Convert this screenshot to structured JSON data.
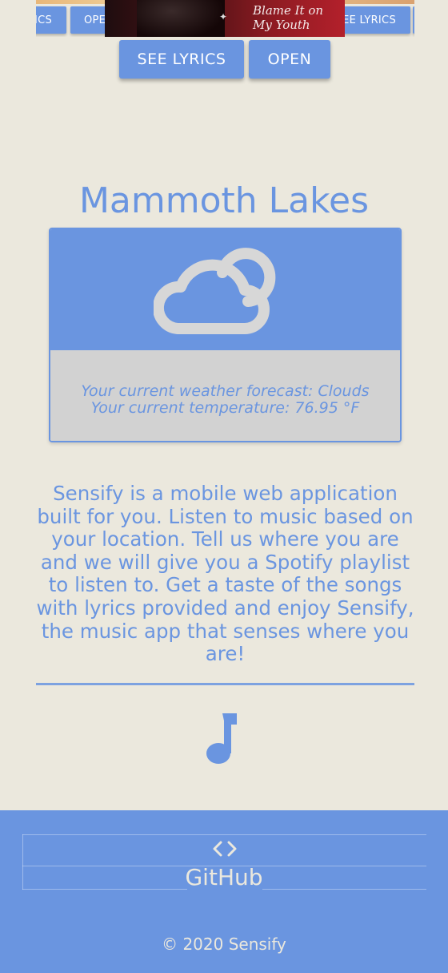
{
  "carousel": {
    "left_button_partial": "ICS",
    "open_button_partial": "OPE",
    "right_button_partial": "EE LYRICS",
    "album_title": "Blame It on My Youth"
  },
  "actions": {
    "see_lyrics_label": "SEE LYRICS",
    "open_label": "OPEN"
  },
  "weather": {
    "city": "Mammoth Lakes",
    "icon": "cloud-icon",
    "forecast_text": "Your current weather forecast: Clouds",
    "temperature_text": "Your current temperature: 76.95 °F"
  },
  "about": {
    "text": "Sensify is a mobile web application built for you. Listen to music based on your location. Tell us where you are and we will give you a Spotify playlist to listen to. Get a taste of the songs with lyrics provided and enjoy Sensify, the music app that senses where you are!"
  },
  "footer": {
    "code_icon": "code-icon",
    "github_label": "GitHub",
    "copyright": "© 2020 Sensify"
  },
  "colors": {
    "accent": "#6a95e0",
    "background": "#ebe8dd",
    "forecast_panel": "#d2d2d2"
  }
}
